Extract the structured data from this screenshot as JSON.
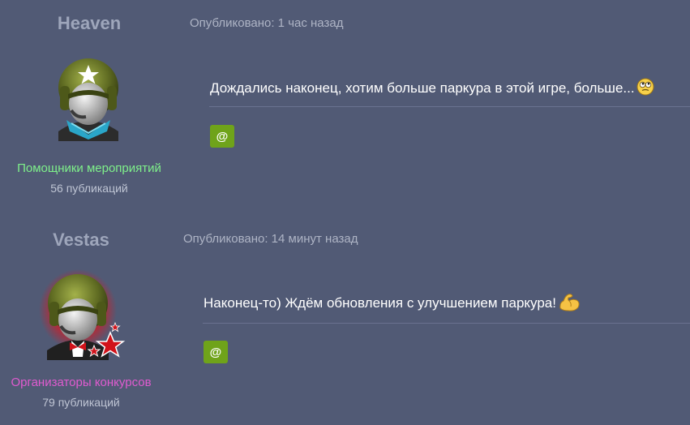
{
  "posts": [
    {
      "author": "Heaven",
      "group": "Помощники мероприятий",
      "group_color": "#7ef08a",
      "post_count": "56 публикаций",
      "timestamp": "Опубликовано: 1 час назад",
      "content": "Дождались наконец, хотим больше паркура в этой игре, больше...",
      "emoji_icon": "rolling-eyes-smiley-icon",
      "mention_label": "@"
    },
    {
      "author": "Vestas",
      "group": "Организаторы конкурсов",
      "group_color": "#e05bd0",
      "post_count": "79 публикаций",
      "timestamp": "Опубликовано: 14 минут назад",
      "content": "Наконец-то) Ждём обновления с улучшением паркура!",
      "emoji_icon": "flexed-biceps-icon",
      "mention_label": "@"
    }
  ]
}
